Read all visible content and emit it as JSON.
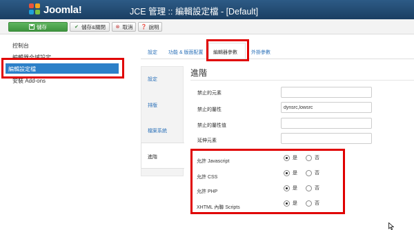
{
  "header": {
    "logo_text": "Joomla!",
    "title": "JCE 管理 :: 編輯設定檔 - [Default]"
  },
  "toolbar": {
    "save": "儲存",
    "save_close": "儲存&關閉",
    "cancel": "取消",
    "help": "說明"
  },
  "sidebar": {
    "items": [
      {
        "label": "控制台"
      },
      {
        "label": "編輯器全域設定"
      },
      {
        "label": "編輯設定檔",
        "active": true
      },
      {
        "label": "安裝 Add-ons"
      }
    ]
  },
  "tabs": [
    {
      "label": "設定"
    },
    {
      "label": "功能 & 版面配置"
    },
    {
      "label": "編輯器參數",
      "active": true
    },
    {
      "label": "外掛參數"
    }
  ],
  "subnav": [
    {
      "label": "設定"
    },
    {
      "label": "排版"
    },
    {
      "label": "檔案系統"
    },
    {
      "label": "進階",
      "active": true
    }
  ],
  "panel": {
    "heading": "進階",
    "fields": [
      {
        "label": "禁止的元素",
        "value": ""
      },
      {
        "label": "禁止的屬性",
        "value": "dynsrc,lowsrc"
      },
      {
        "label": "禁止的屬性值",
        "value": ""
      },
      {
        "label": "延伸元素",
        "value": ""
      }
    ],
    "options": [
      {
        "label": "允許 Javascript",
        "yes": "是",
        "no": "否",
        "selected": "是"
      },
      {
        "label": "允許 CSS",
        "yes": "是",
        "no": "否",
        "selected": "是"
      },
      {
        "label": "允許 PHP",
        "yes": "是",
        "no": "否",
        "selected": "是"
      },
      {
        "label": "XHTML 內聯 Scripts",
        "yes": "是",
        "no": "否",
        "selected": "是"
      }
    ]
  },
  "colors": {
    "header_bg": "#1b3e62",
    "active_blue": "#2c80c8",
    "highlight_red": "#e00000",
    "save_green": "#3f943f"
  }
}
